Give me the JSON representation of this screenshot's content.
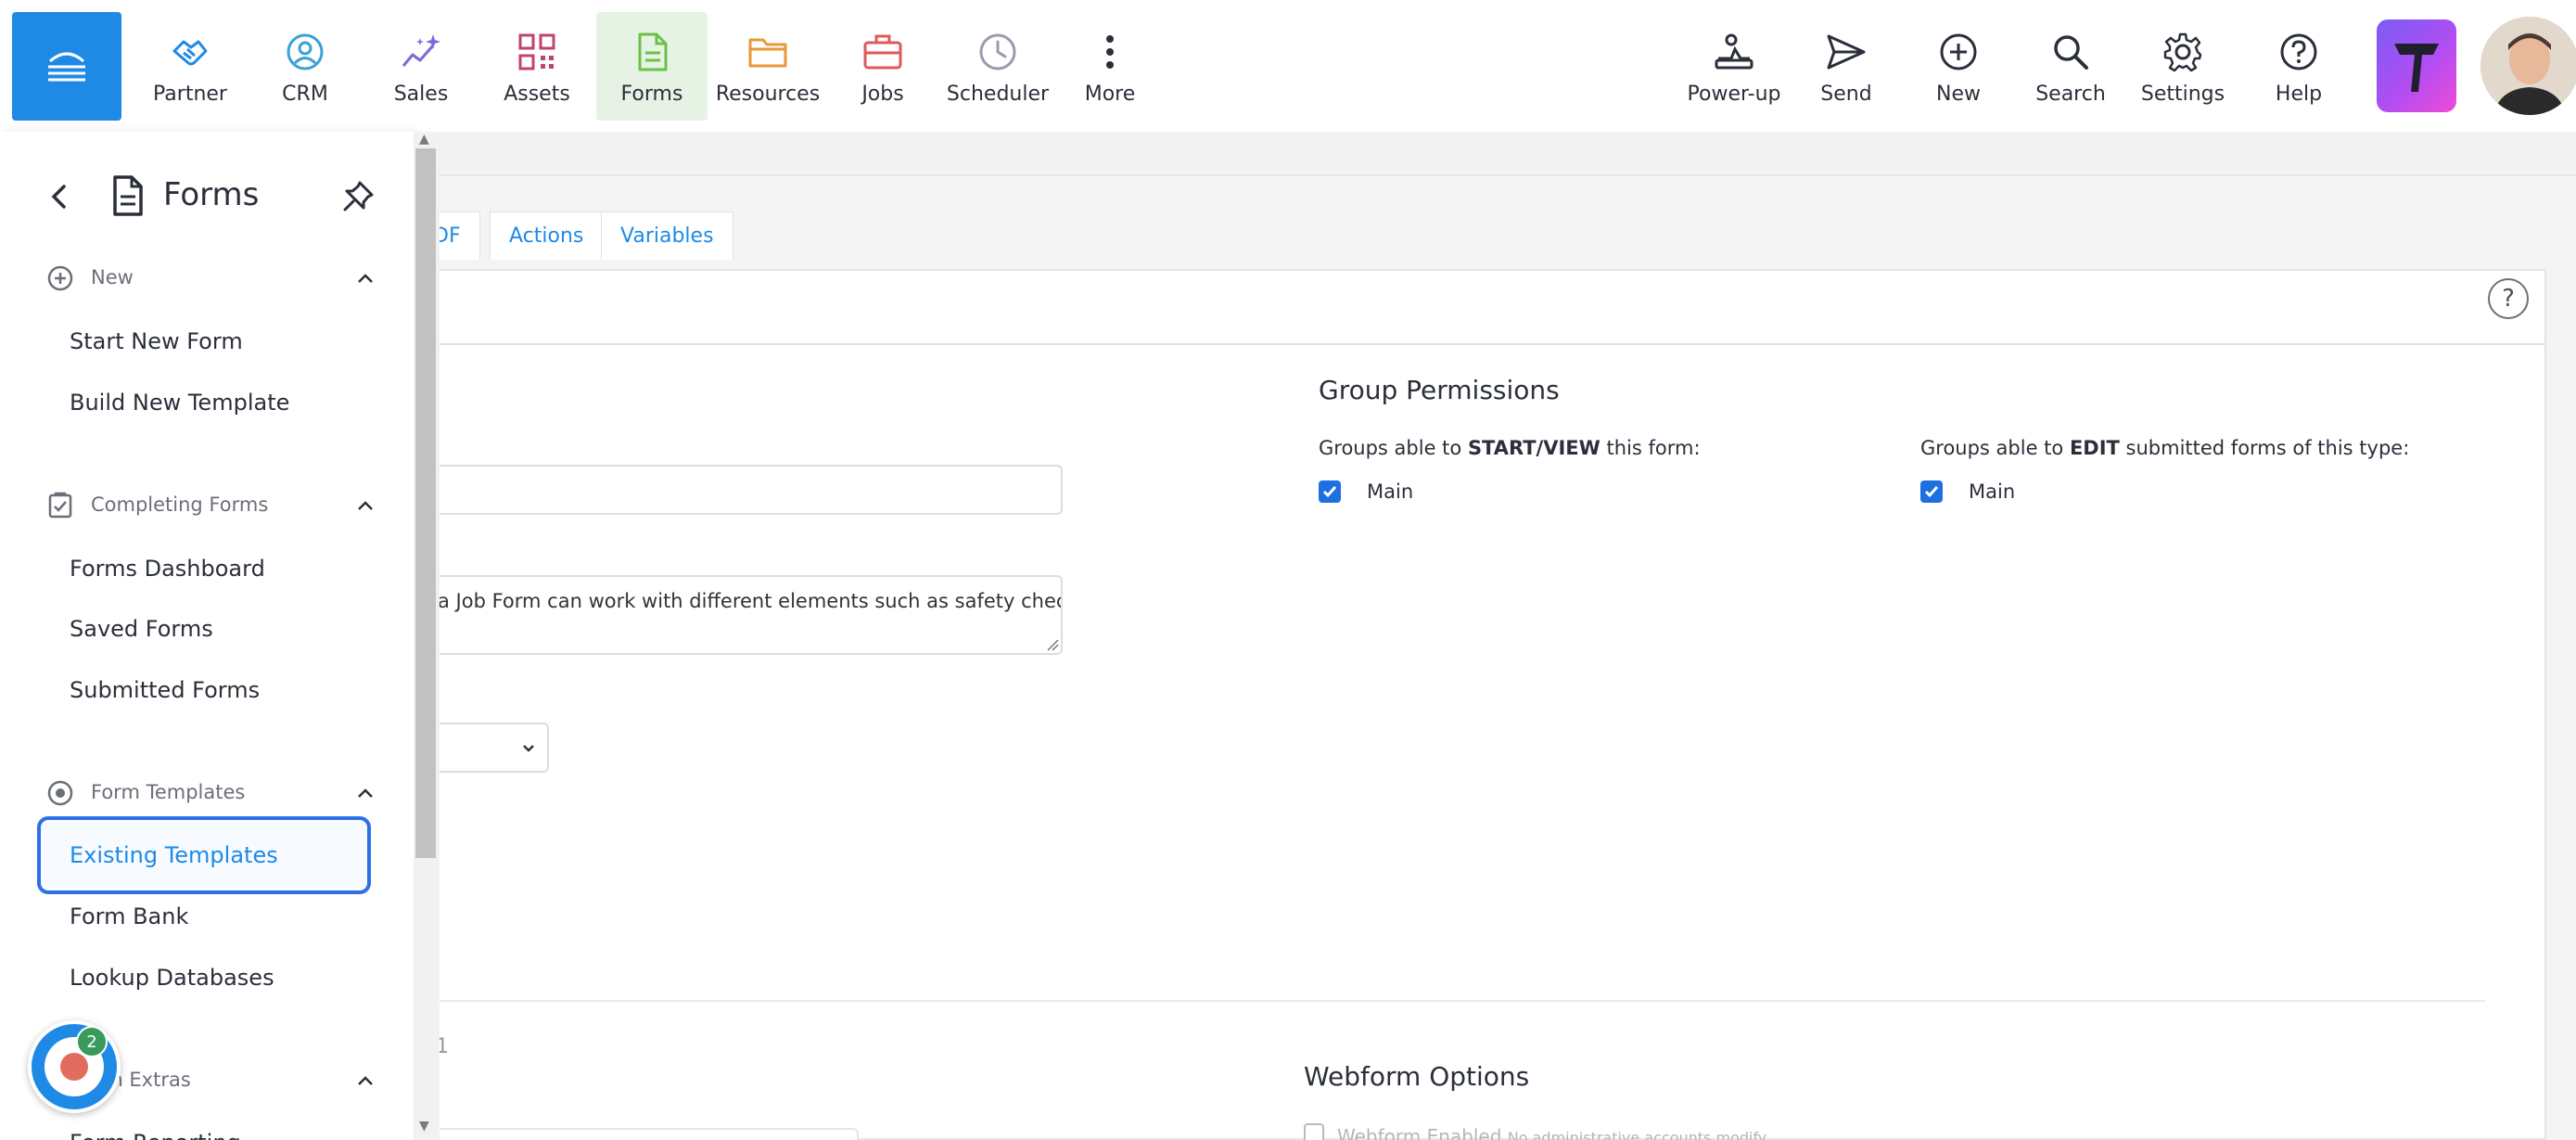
{
  "nav": {
    "left_items": [
      {
        "label": "Partner",
        "icon": "handshake-icon"
      },
      {
        "label": "CRM",
        "icon": "user-circle-icon"
      },
      {
        "label": "Sales",
        "icon": "sparkle-chart-icon"
      },
      {
        "label": "Assets",
        "icon": "qr-code-icon"
      },
      {
        "label": "Forms",
        "icon": "document-icon"
      },
      {
        "label": "Resources",
        "icon": "folder-icon"
      },
      {
        "label": "Jobs",
        "icon": "briefcase-icon"
      },
      {
        "label": "Scheduler",
        "icon": "clock-icon"
      },
      {
        "label": "More",
        "icon": "more-vertical-icon"
      }
    ],
    "right_items": [
      {
        "label": "Power-up",
        "icon": "power-up-icon"
      },
      {
        "label": "Send",
        "icon": "send-icon"
      },
      {
        "label": "New",
        "icon": "plus-circle-icon"
      },
      {
        "label": "Search",
        "icon": "search-icon"
      },
      {
        "label": "Settings",
        "icon": "gear-icon"
      },
      {
        "label": "Help",
        "icon": "help-circle-icon"
      }
    ],
    "active": "Forms",
    "colors": {
      "accent": "#1e8ae6",
      "active_bg": "#e6f3e4"
    }
  },
  "sidebar": {
    "title": "Forms",
    "sections": [
      {
        "label": "New",
        "icon": "plus-circle-icon",
        "items": [
          "Start New Form",
          "Build New Template"
        ]
      },
      {
        "label": "Completing Forms",
        "icon": "clipboard-check-icon",
        "items": [
          "Forms Dashboard",
          "Saved Forms",
          "Submitted Forms"
        ]
      },
      {
        "label": "Form Templates",
        "icon": "radio-circle-icon",
        "items": [
          "Existing Templates",
          "Form Bank",
          "Lookup Databases"
        ]
      },
      {
        "label": "rm Extras",
        "icon": "",
        "items": [
          "Form Reporting"
        ]
      }
    ],
    "selected_item": "Existing Templates"
  },
  "tabs": [
    "DF",
    "Actions",
    "Variables"
  ],
  "form": {
    "description_text": "a Job Form can work with different elements such as safety checks,",
    "partial_counter": "1"
  },
  "group_permissions": {
    "title": "Group Permissions",
    "start_view_prefix": "Groups able to ",
    "start_view_bold": "START/VIEW",
    "start_view_suffix": " this form:",
    "start_view_group": "Main",
    "start_view_checked": true,
    "edit_prefix": "Groups able to ",
    "edit_bold": "EDIT",
    "edit_suffix": " submitted forms of this type:",
    "edit_group": "Main",
    "edit_checked": true
  },
  "webform": {
    "title": "Webform Options",
    "enabled_label": "Webform Enabled",
    "enabled_note": "No administrative accounts modify",
    "enabled_checked": false
  },
  "help_icon": "?",
  "recorder": {
    "badge_count": "2"
  }
}
